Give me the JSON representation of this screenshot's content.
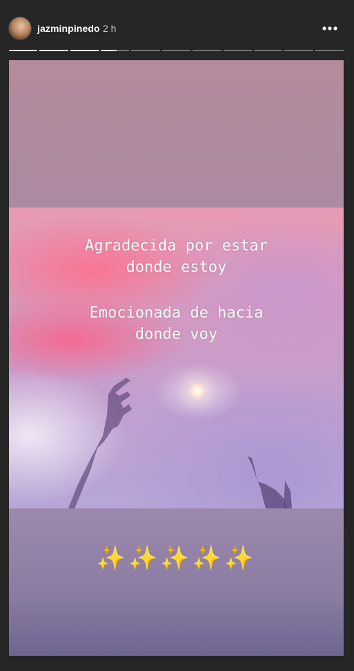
{
  "header": {
    "username": "jazminpinedo",
    "timestamp": "2 h",
    "more_icon": "more-horizontal-icon"
  },
  "progress": {
    "segments": [
      1,
      1,
      1,
      0.55,
      0,
      0,
      0,
      0,
      0,
      0,
      0
    ]
  },
  "story": {
    "caption_lines_1": [
      "Agradecida por estar",
      "donde estoy"
    ],
    "caption_lines_2": [
      "Emocionada de hacia",
      "donde voy"
    ],
    "sparkles": "✨✨✨✨✨"
  },
  "colors": {
    "background": "#262626",
    "text": "#ffffff",
    "muted": "#c8c8c8",
    "sparkle": "#f5c543"
  }
}
